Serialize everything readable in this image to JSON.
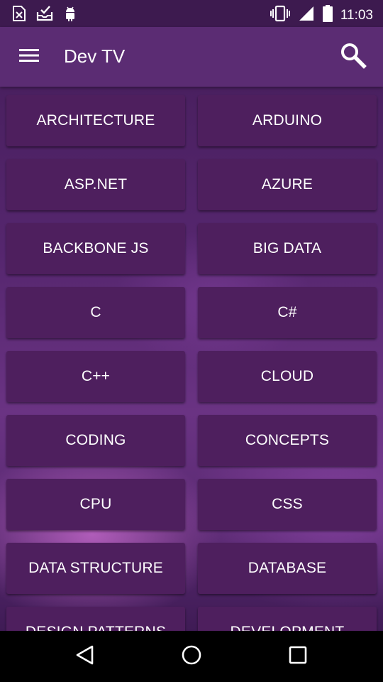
{
  "status_bar": {
    "time": "11:03",
    "left_icons": [
      "sim-error-icon",
      "inbox-check-icon",
      "android-icon"
    ],
    "right_icons": [
      "vibrate-icon",
      "signal-icon",
      "battery-icon"
    ]
  },
  "app_bar": {
    "title": "Dev TV",
    "menu_icon": "menu-icon",
    "search_icon": "search-icon"
  },
  "categories": [
    "ARCHITECTURE",
    "ARDUINO",
    "ASP.NET",
    "AZURE",
    "BACKBONE JS",
    "BIG DATA",
    "C",
    "C#",
    "C++",
    "CLOUD",
    "CODING",
    "CONCEPTS",
    "CPU",
    "CSS",
    "DATA STRUCTURE",
    "DATABASE",
    "DESIGN PATTERNS",
    "DEVELOPMENT"
  ],
  "nav_bar": {
    "icons": [
      "back-icon",
      "home-icon",
      "recents-icon"
    ]
  },
  "colors": {
    "status_bar": "#3d1a4f",
    "app_bar": "#5b2c73",
    "tile": "#4e1f5e",
    "text": "#ffffff"
  }
}
